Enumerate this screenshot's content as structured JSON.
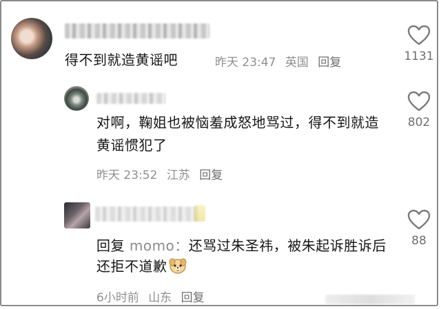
{
  "comments": [
    {
      "text": "得不到就造黄谣吧",
      "time": "昨天 23:47",
      "location": "英国",
      "reply": "回复",
      "likes": "1131"
    },
    {
      "text": "对啊，鞠姐也被恼羞成怒地骂过，得不到就造黄谣惯犯了",
      "time": "昨天 23:52",
      "location": "江苏",
      "reply": "回复",
      "likes": "802"
    },
    {
      "reply_prefix": "回复",
      "mention": "momo：",
      "text": "还骂过朱圣祎，被朱起诉胜诉后还拒不道歉",
      "time": "6小时前",
      "location": "山东",
      "reply": "回复",
      "likes": "88"
    }
  ],
  "icons": {
    "like": "heart-outline-icon",
    "emoji": "dog-face-emoji-icon"
  },
  "colors": {
    "text": "#161616",
    "meta": "#8f8f8f",
    "icon": "#7a7a7a"
  }
}
